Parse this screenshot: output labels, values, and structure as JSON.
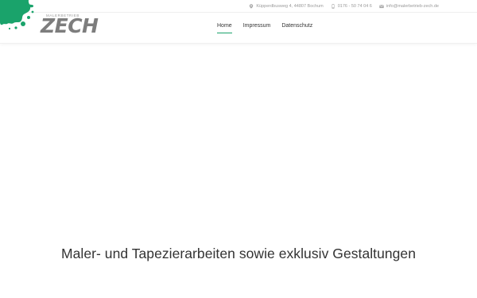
{
  "topbar": {
    "address": "Küpperdbusweg 4, 44807 Bochum",
    "phone": "0176 - 50 74 04 6",
    "email": "info@malerbetrieb-zech.de",
    "icon_color": "#a8a8a8"
  },
  "logo": {
    "tagline": "MALERBETRIEB",
    "wordmark": "ZECH",
    "splash_color": "#1aa36b",
    "word_color": "#7d7d7d"
  },
  "nav": {
    "items": [
      {
        "label": "Home",
        "active": true
      },
      {
        "label": "Impressum",
        "active": false
      },
      {
        "label": "Datenschutz",
        "active": false
      }
    ],
    "accent_color": "#1aa36b"
  },
  "hero": {
    "headline": "Maler- und Tapezierarbeiten sowie exklusiv Gestaltungen"
  }
}
